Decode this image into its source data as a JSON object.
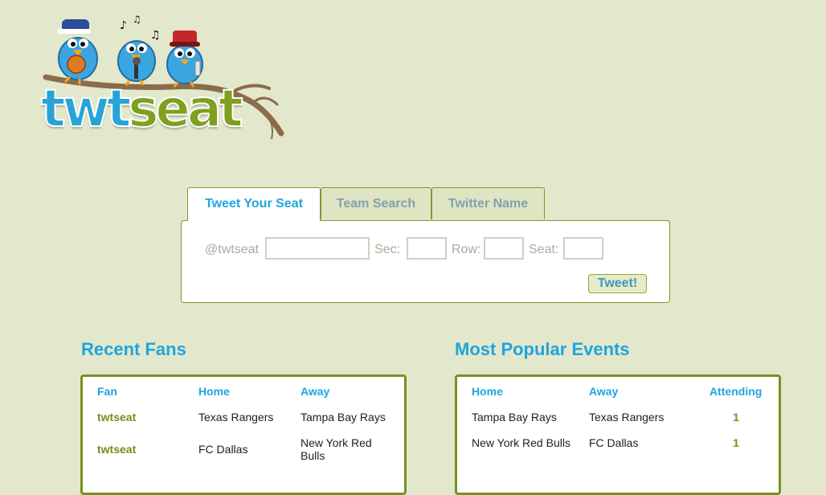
{
  "logo": {
    "part1": "twt",
    "part2": "seat",
    "icon": "twitter-birds-on-branch"
  },
  "tabs": [
    {
      "label": "Tweet Your Seat",
      "active": true
    },
    {
      "label": "Team Search",
      "active": false
    },
    {
      "label": "Twitter Name",
      "active": false
    }
  ],
  "tweet_form": {
    "handle_label": "@twtseat",
    "sec_label": "Sec:",
    "row_label": "Row:",
    "seat_label": "Seat:",
    "handle_value": "",
    "sec_value": "",
    "row_value": "",
    "seat_value": "",
    "button_label": "Tweet!"
  },
  "recent_fans": {
    "title": "Recent Fans",
    "columns": [
      "Fan",
      "Home",
      "Away"
    ],
    "rows": [
      {
        "fan": "twtseat",
        "home": "Texas Rangers",
        "away": "Tampa Bay Rays"
      },
      {
        "fan": "twtseat",
        "home": "FC Dallas",
        "away": "New York Red Bulls"
      }
    ]
  },
  "popular_events": {
    "title": "Most Popular Events",
    "columns": [
      "Home",
      "Away",
      "Attending"
    ],
    "rows": [
      {
        "home": "Tampa Bay Rays",
        "away": "Texas Rangers",
        "attending": "1"
      },
      {
        "home": "New York Red Bulls",
        "away": "FC Dallas",
        "attending": "1"
      }
    ]
  },
  "colors": {
    "background": "#e3e7cc",
    "accent_blue": "#1ea5de",
    "accent_green": "#77921f"
  }
}
